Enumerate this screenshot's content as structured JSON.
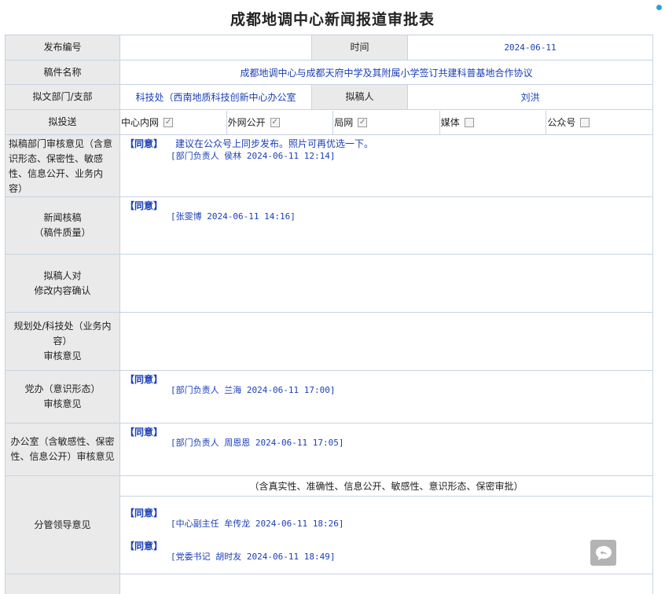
{
  "page_title": "成都地调中心新闻报道审批表",
  "fields": {
    "doc_no_label": "发布编号",
    "doc_no_value": "",
    "time_label": "时间",
    "time_value": "2024-06-11",
    "article_name_label": "稿件名称",
    "article_name_value": "成都地调中心与成都天府中学及其附属小学签订共建科普基地合作协议",
    "dept_label": "拟文部门/支部",
    "dept_value": "科技处（西南地质科技创新中心办公室",
    "drafter_label": "拟稿人",
    "drafter_value": "刘洪",
    "send_label": "拟投送"
  },
  "send_targets": [
    {
      "label": "中心内网",
      "checked": true,
      "check_glyph": "✓"
    },
    {
      "label": "外网公开",
      "checked": true,
      "check_glyph": "✓"
    },
    {
      "label": "局网",
      "checked": true,
      "check_glyph": "✓"
    },
    {
      "label": "媒体",
      "checked": false,
      "check_glyph": ""
    },
    {
      "label": "公众号",
      "checked": false,
      "check_glyph": ""
    }
  ],
  "reviews": {
    "dept_review": {
      "label": "拟稿部门审核意见（含意识形态、保密性、敏感性、信息公开、业务内容）",
      "agree": "【同意】",
      "note": "建议在公众号上同步发布。照片可再优选一下。",
      "sign": "[部门负责人 侯林 2024-06-11 12:14]"
    },
    "news_review": {
      "label_line1": "新闻核稿",
      "label_line2": "（稿件质量）",
      "agree": "【同意】",
      "sign": "[张雯博 2024-06-11 14:16]"
    },
    "drafter_confirm": {
      "label_line1": "拟稿人对",
      "label_line2": "修改内容确认"
    },
    "planning_review": {
      "label_line1": "规划处/科技处（业务内容）",
      "label_line2": "审核意见"
    },
    "party_review": {
      "label_line1": "党办（意识形态）",
      "label_line2": "审核意见",
      "agree": "【同意】",
      "sign": "[部门负责人 兰海 2024-06-11 17:00]"
    },
    "office_review": {
      "label": "办公室（含敏感性、保密性、信息公开）审核意见",
      "agree": "【同意】",
      "sign": "[部门负责人 周恩恩 2024-06-11 17:05]"
    },
    "leader_review": {
      "label": "分管领导意见",
      "scope": "（含真实性、准确性、信息公开、敏感性、意识形态、保密审批）",
      "agree1": "【同意】",
      "sign1": "[中心副主任 牟传龙 2024-06-11 18:26]",
      "agree2": "【同意】",
      "sign2": "[党委书记 胡时友 2024-06-11 18:49]"
    }
  },
  "floating": {
    "chat_icon": "comment-bubble-icon"
  },
  "colors": {
    "link_blue": "#1b3fb8",
    "label_bg": "#eaeaea",
    "border": "#c8d3e0"
  }
}
